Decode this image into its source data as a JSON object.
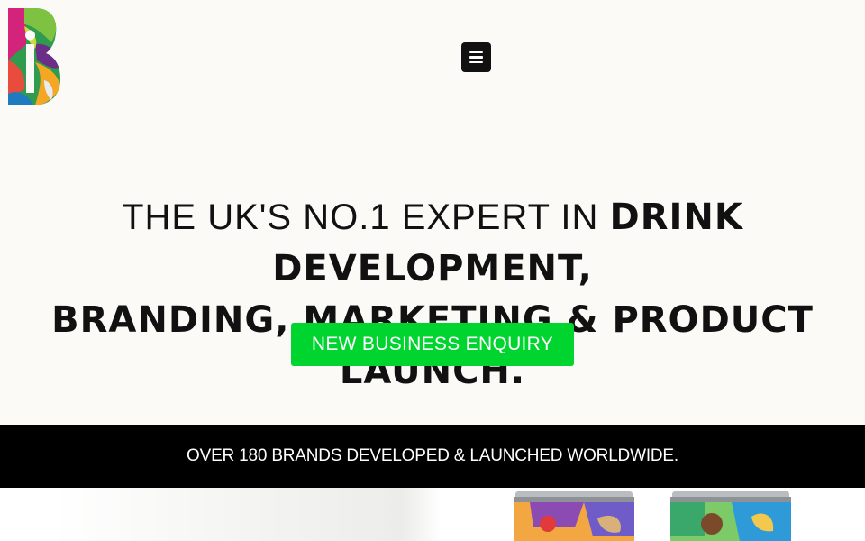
{
  "header": {
    "logo_alt": "B brand logo",
    "menu_label": "Menu"
  },
  "hero": {
    "headline_light_1": "THE UK'S NO.1 EXPERT IN ",
    "headline_bold_1": "DRINK DEVELOPMENT,",
    "headline_bold_2": "BRANDING, MARKETING & PRODUCT LAUNCH.",
    "cta_label": "NEW BUSINESS ENQUIRY"
  },
  "banner": {
    "text": "OVER 180 BRANDS DEVELOPED & LAUNCHED WORLDWIDE."
  },
  "colors": {
    "background": "#fbfaf6",
    "cta": "#00d52f",
    "banner": "#000000"
  },
  "icons": [
    "logo-icon",
    "menu-icon"
  ]
}
